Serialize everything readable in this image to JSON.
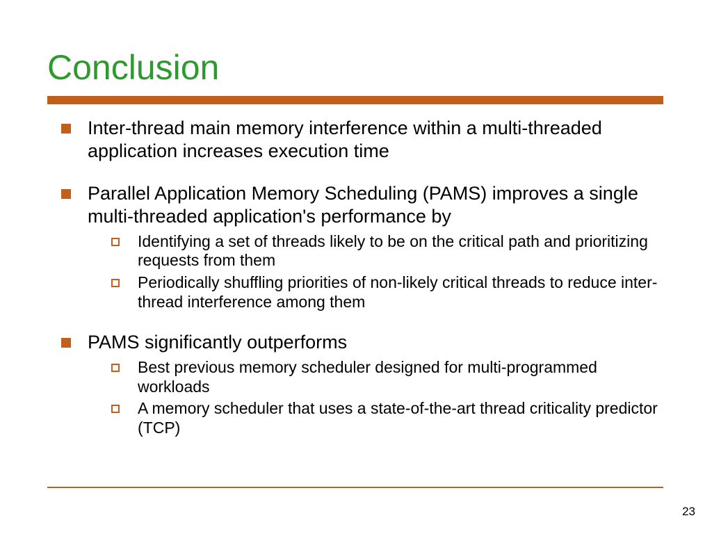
{
  "title": "Conclusion",
  "points": [
    {
      "text": "Inter-thread main memory interference within a multi-threaded application increases execution time",
      "sub": []
    },
    {
      "text": "Parallel Application Memory Scheduling (PAMS) improves a single multi-threaded application's performance by",
      "sub": [
        "Identifying a set of threads likely to be on the critical path and prioritizing requests from them",
        "Periodically shuffling priorities of non-likely critical threads to reduce inter-thread interference among them"
      ]
    },
    {
      "text": "PAMS significantly outperforms",
      "sub": [
        "Best previous memory scheduler designed for multi-programmed workloads",
        "A memory scheduler that uses a state-of-the-art thread criticality predictor (TCP)"
      ]
    }
  ],
  "page_number": "23"
}
